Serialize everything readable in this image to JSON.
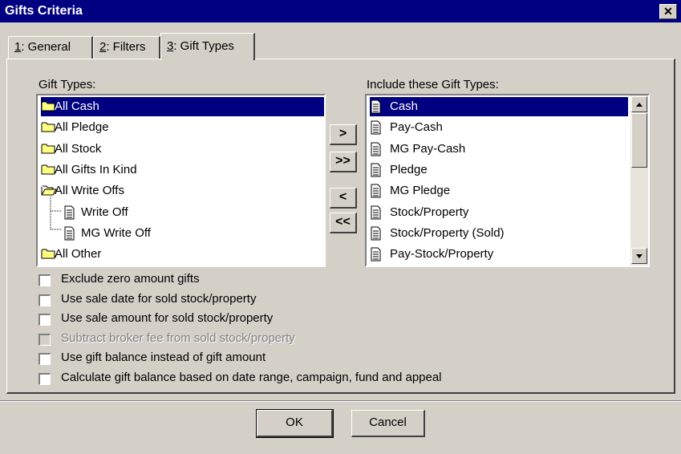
{
  "window": {
    "title": "Gifts Criteria",
    "close_glyph": "✕"
  },
  "tabs": [
    {
      "key": "1",
      "rest": ": General"
    },
    {
      "key": "2",
      "rest": ": Filters"
    },
    {
      "key": "3",
      "rest": ": Gift Types"
    }
  ],
  "gift_types": {
    "label": "Gift Types:",
    "items": [
      {
        "label": "All Cash",
        "icon": "folder-icon",
        "selected": true
      },
      {
        "label": "All Pledge",
        "icon": "folder-icon"
      },
      {
        "label": "All Stock",
        "icon": "folder-icon"
      },
      {
        "label": "All Gifts In Kind",
        "icon": "folder-icon"
      },
      {
        "label": "All Write Offs",
        "icon": "folder-open-icon"
      },
      {
        "label": "Write Off",
        "icon": "document-icon"
      },
      {
        "label": "MG Write Off",
        "icon": "document-icon"
      },
      {
        "label": "All Other",
        "icon": "folder-icon"
      }
    ]
  },
  "move_buttons": {
    "add_one": ">",
    "add_all": ">>",
    "remove_one": "<",
    "remove_all": "<<"
  },
  "included": {
    "label": "Include these Gift Types:",
    "items": [
      {
        "label": "Cash",
        "selected": true
      },
      {
        "label": "Pay-Cash"
      },
      {
        "label": "MG Pay-Cash"
      },
      {
        "label": "Pledge"
      },
      {
        "label": "MG Pledge"
      },
      {
        "label": "Stock/Property"
      },
      {
        "label": "Stock/Property (Sold)"
      },
      {
        "label": "Pay-Stock/Property"
      }
    ]
  },
  "options": [
    {
      "label": "Exclude zero amount gifts",
      "checked": false,
      "enabled": true
    },
    {
      "label": "Use sale date for sold stock/property",
      "checked": false,
      "enabled": true
    },
    {
      "label": "Use sale amount for sold stock/property",
      "checked": false,
      "enabled": true
    },
    {
      "label": "Subtract broker fee from sold stock/property",
      "checked": false,
      "enabled": false
    },
    {
      "label": "Use gift balance instead of gift amount",
      "checked": false,
      "enabled": true
    },
    {
      "label": "Calculate gift balance based on date range, campaign, fund and appeal",
      "checked": false,
      "enabled": true
    }
  ],
  "footer": {
    "ok_label": "OK",
    "cancel_label": "Cancel"
  }
}
